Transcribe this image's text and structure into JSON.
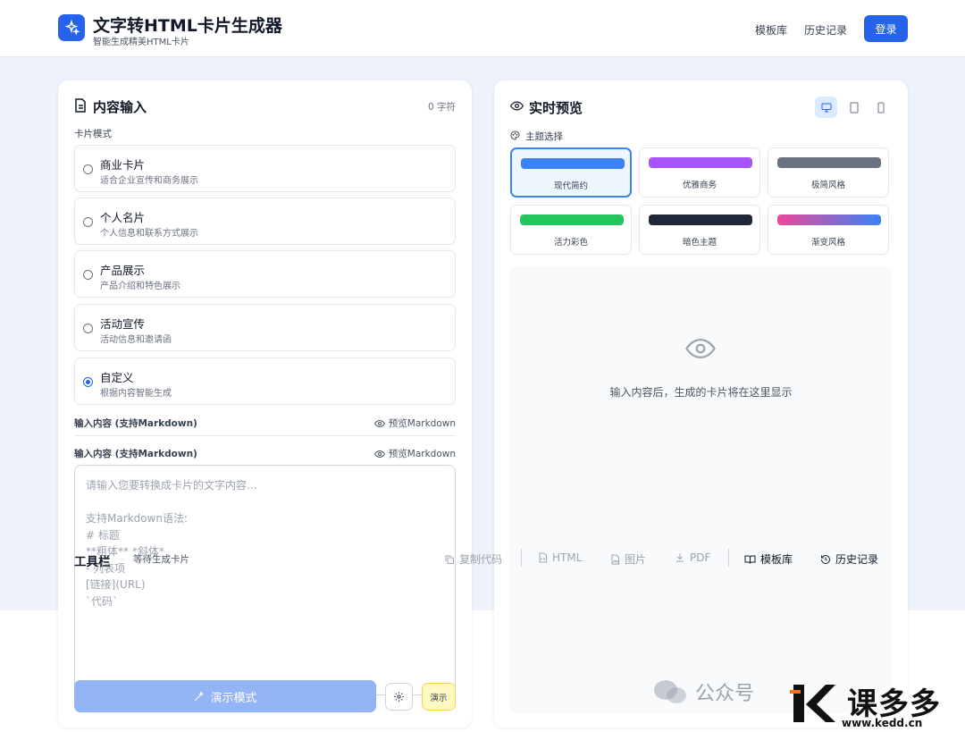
{
  "header": {
    "title": "文字转HTML卡片生成器",
    "subtitle": "智能生成精美HTML卡片",
    "nav": [
      "模板库",
      "历史记录"
    ],
    "login": "登录"
  },
  "input_panel": {
    "title": "内容输入",
    "char_count": "0 字符",
    "mode_label": "卡片模式",
    "modes": [
      {
        "name": "商业卡片",
        "desc": "适合企业宣传和商务展示",
        "selected": false
      },
      {
        "name": "个人名片",
        "desc": "个人信息和联系方式展示",
        "selected": false
      },
      {
        "name": "产品展示",
        "desc": "产品介绍和特色展示",
        "selected": false
      },
      {
        "name": "活动宣传",
        "desc": "活动信息和邀请函",
        "selected": false
      },
      {
        "name": "自定义",
        "desc": "根据内容智能生成",
        "selected": true
      }
    ],
    "content_label": "输入内容 (支持Markdown)",
    "preview_markdown": "预览Markdown",
    "placeholder": "请输入您要转换成卡片的文字内容...\n\n支持Markdown语法:\n# 标题\n**粗体** *斜体*\n- 列表项\n[链接](URL)\n`代码`",
    "demo_button": "演示模式",
    "demo_badge": "演示"
  },
  "preview_panel": {
    "title": "实时预览",
    "theme_label": "主题选择",
    "themes": [
      {
        "name": "现代简约",
        "color": "#3b82f6",
        "selected": true
      },
      {
        "name": "优雅商务",
        "color": "#a855f7",
        "selected": false
      },
      {
        "name": "极简风格",
        "color": "#6b7280",
        "selected": false
      },
      {
        "name": "活力彩色",
        "color": "#22c55e",
        "selected": false
      },
      {
        "name": "暗色主题",
        "color": "#1f2937",
        "selected": false
      },
      {
        "name": "渐变风格",
        "color": "linear-gradient(90deg,#ec4899,#3b82f6)",
        "selected": false
      }
    ],
    "empty_message": "输入内容后，生成的卡片将在这里显示"
  },
  "toolbar": {
    "title": "工具栏",
    "status": "等待生成卡片",
    "copy_code": "复制代码",
    "html": "HTML",
    "image": "图片",
    "pdf": "PDF",
    "template_library": "模板库",
    "history": "历史记录"
  },
  "watermark": {
    "wechat": "公众号",
    "brand": "课多多",
    "url": "www.kedd.cn"
  },
  "colors": {
    "accent": "#2563eb",
    "background": "#eef3fb"
  }
}
